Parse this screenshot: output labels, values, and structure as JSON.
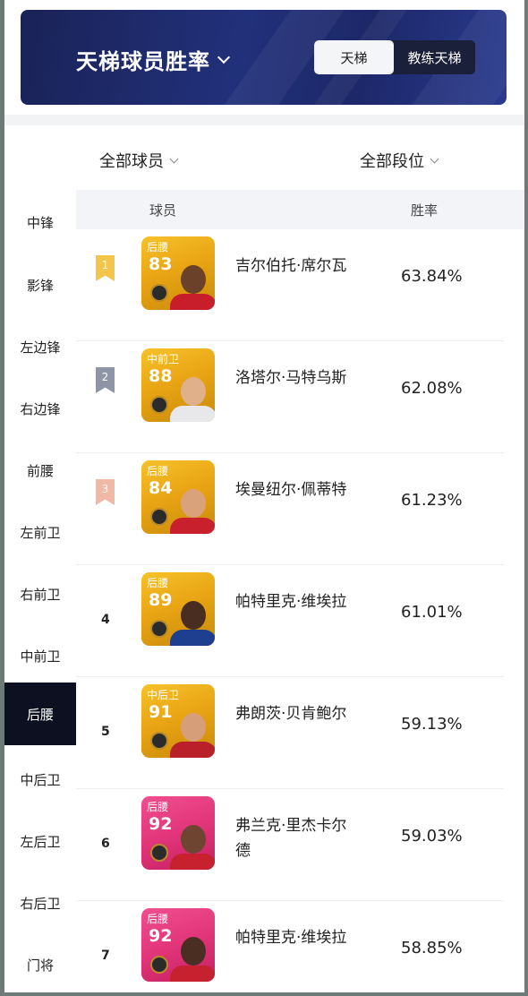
{
  "header": {
    "title": "天梯球员胜率",
    "tabs": [
      {
        "label": "天梯",
        "active": true
      },
      {
        "label": "教练天梯",
        "active": false
      }
    ]
  },
  "filters": {
    "players": "全部球员",
    "tiers": "全部段位"
  },
  "sidebar": {
    "items": [
      {
        "label": "中锋"
      },
      {
        "label": "影锋"
      },
      {
        "label": "左边锋"
      },
      {
        "label": "右边锋"
      },
      {
        "label": "前腰"
      },
      {
        "label": "左前卫"
      },
      {
        "label": "右前卫"
      },
      {
        "label": "中前卫"
      },
      {
        "label": "后腰",
        "active": true
      },
      {
        "label": "中后卫"
      },
      {
        "label": "左后卫"
      },
      {
        "label": "右后卫"
      },
      {
        "label": "门将"
      }
    ]
  },
  "table": {
    "columns": [
      "球员",
      "胜率"
    ],
    "rows": [
      {
        "rank": "1",
        "position": "后腰",
        "rating": "83",
        "name": "吉尔伯托·席尔瓦",
        "rate": "63.84%",
        "card": "gold",
        "badge_color": "#f3c54b"
      },
      {
        "rank": "2",
        "position": "中前卫",
        "rating": "88",
        "name": "洛塔尔·马特乌斯",
        "rate": "62.08%",
        "card": "gold",
        "badge_color": "#8e95a6"
      },
      {
        "rank": "3",
        "position": "后腰",
        "rating": "84",
        "name": "埃曼纽尔·佩蒂特",
        "rate": "61.23%",
        "card": "gold",
        "badge_color": "#f0b9a5"
      },
      {
        "rank": "4",
        "position": "后腰",
        "rating": "89",
        "name": "帕特里克·维埃拉",
        "rate": "61.01%",
        "card": "gold"
      },
      {
        "rank": "5",
        "position": "中后卫",
        "rating": "91",
        "name": "弗朗茨·贝肯鲍尔",
        "rate": "59.13%",
        "card": "gold"
      },
      {
        "rank": "6",
        "position": "后腰",
        "rating": "92",
        "name": "弗兰克·里杰卡尔德",
        "rate": "59.03%",
        "card": "pink"
      },
      {
        "rank": "7",
        "position": "后腰",
        "rating": "92",
        "name": "帕特里克·维埃拉",
        "rate": "58.85%",
        "card": "pink"
      }
    ]
  }
}
